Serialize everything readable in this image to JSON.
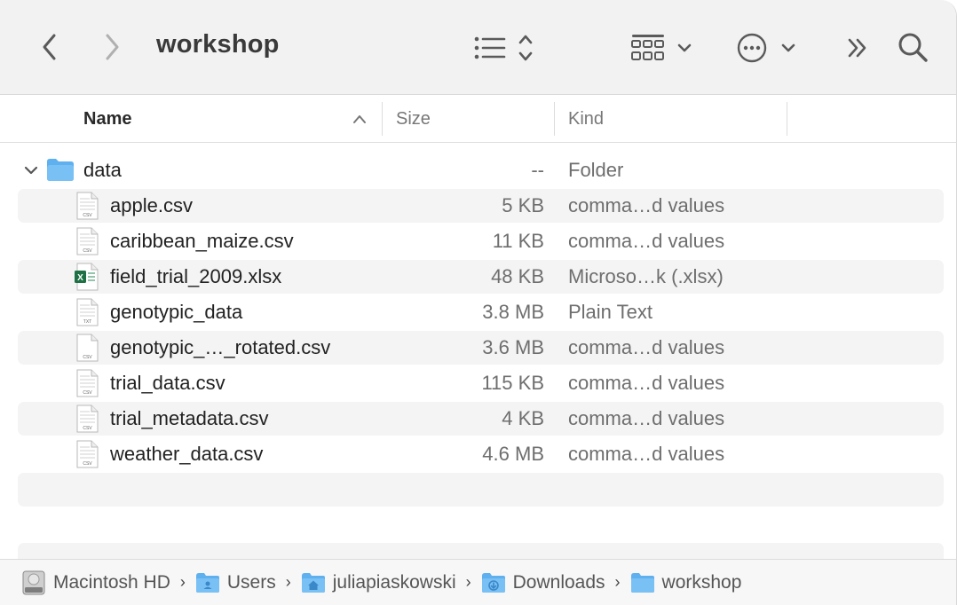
{
  "window": {
    "title": "workshop"
  },
  "toolbar": {
    "back_icon": "chevron-left-icon",
    "forward_icon": "chevron-right-icon",
    "view_list_icon": "list-view-icon",
    "view_group_icon": "grid-view-icon",
    "more_icon": "ellipsis-circle-icon",
    "overflow_icon": "double-chevron-icon",
    "search_icon": "search-icon"
  },
  "columns": {
    "name": "Name",
    "size": "Size",
    "kind": "Kind"
  },
  "folder": {
    "name": "data",
    "size": "--",
    "kind": "Folder"
  },
  "files": [
    {
      "name": "apple.csv",
      "size": "5 KB",
      "kind": "comma…d values",
      "icon": "csv-file-icon",
      "badge": "CSV"
    },
    {
      "name": "caribbean_maize.csv",
      "size": "11 KB",
      "kind": "comma…d values",
      "icon": "csv-file-icon",
      "badge": "CSV"
    },
    {
      "name": "field_trial_2009.xlsx",
      "size": "48 KB",
      "kind": "Microso…k (.xlsx)",
      "icon": "excel-file-icon",
      "badge": "X"
    },
    {
      "name": "genotypic_data",
      "size": "3.8 MB",
      "kind": "Plain Text",
      "icon": "txt-file-icon",
      "badge": "TXT"
    },
    {
      "name": "genotypic_…_rotated.csv",
      "size": "3.6 MB",
      "kind": "comma…d values",
      "icon": "csv-file-icon",
      "badge": "CSV"
    },
    {
      "name": "trial_data.csv",
      "size": "115 KB",
      "kind": "comma…d values",
      "icon": "csv-file-icon",
      "badge": "CSV"
    },
    {
      "name": "trial_metadata.csv",
      "size": "4 KB",
      "kind": "comma…d values",
      "icon": "csv-file-icon",
      "badge": "CSV"
    },
    {
      "name": "weather_data.csv",
      "size": "4.6 MB",
      "kind": "comma…d values",
      "icon": "csv-file-icon",
      "badge": "CSV"
    }
  ],
  "pathbar": {
    "items": [
      {
        "label": "Macintosh HD",
        "icon": "hard-drive-icon"
      },
      {
        "label": "Users",
        "icon": "folder-icon"
      },
      {
        "label": "juliapiaskowski",
        "icon": "home-folder-icon"
      },
      {
        "label": "Downloads",
        "icon": "downloads-folder-icon"
      },
      {
        "label": "workshop",
        "icon": "folder-icon"
      }
    ]
  },
  "colors": {
    "accent": "#4da3e8",
    "folder": "#5fb0ef",
    "excel": "#1e7145",
    "stripe": "#f4f4f4"
  }
}
